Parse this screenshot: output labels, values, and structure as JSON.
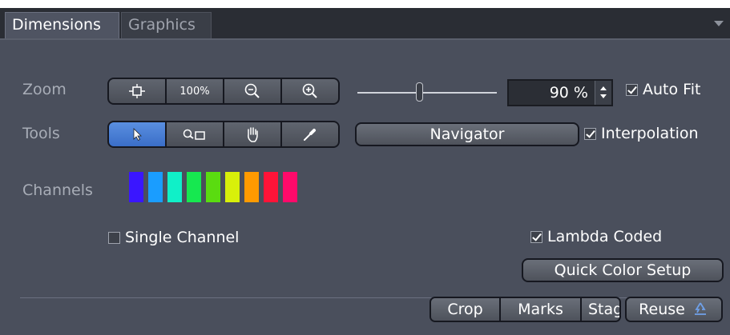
{
  "tabs": [
    {
      "label": "Dimensions",
      "active": true
    },
    {
      "label": "Graphics",
      "active": false
    }
  ],
  "zoom": {
    "label": "Zoom",
    "buttons": [
      {
        "name": "fit-icon"
      },
      {
        "label": "100%"
      },
      {
        "name": "zoom-out-icon"
      },
      {
        "name": "zoom-in-icon"
      }
    ],
    "slider_value_percent": 90,
    "value_text": "90 %",
    "autofit_label": "Auto Fit",
    "autofit_checked": true
  },
  "tools": {
    "label": "Tools",
    "buttons": [
      {
        "name": "pointer-icon",
        "active": true
      },
      {
        "name": "zoom-rect-icon",
        "active": false
      },
      {
        "name": "hand-icon",
        "active": false
      },
      {
        "name": "eyedropper-icon",
        "active": false
      }
    ],
    "navigator_label": "Navigator",
    "interpolation_label": "Interpolation",
    "interpolation_checked": true
  },
  "channels": {
    "label": "Channels",
    "colors": [
      "#3a16ff",
      "#1a9dff",
      "#10f0c8",
      "#16e850",
      "#5adc10",
      "#d8f00a",
      "#ff9a00",
      "#ff1438",
      "#ff0a6a"
    ],
    "single_channel_label": "Single Channel",
    "single_channel_checked": false,
    "lambda_coded_label": "Lambda Coded",
    "lambda_coded_checked": true,
    "quick_color_setup_label": "Quick Color Setup"
  },
  "bottom": {
    "crop_label": "Crop",
    "marks_label": "Marks",
    "stage_label": "Stage",
    "reuse_label": "Reuse"
  }
}
